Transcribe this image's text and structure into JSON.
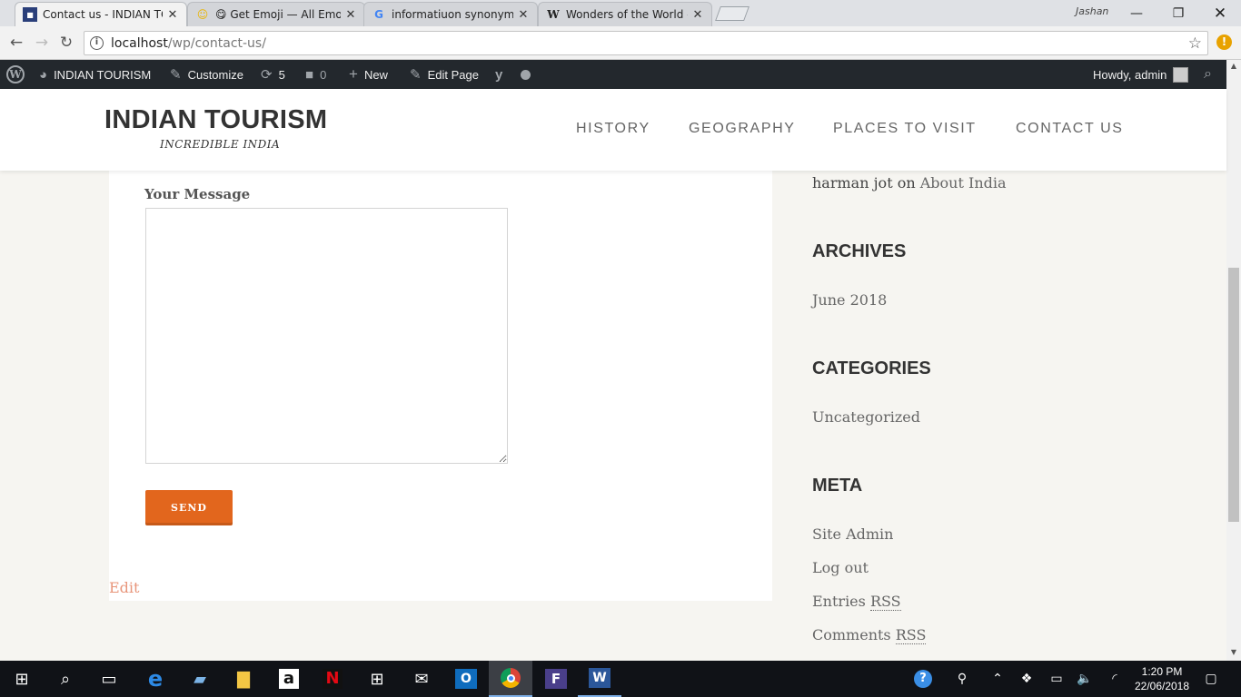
{
  "browser": {
    "tabs": [
      {
        "title": "Contact us - INDIAN TOU",
        "favicon": "site-favicon",
        "active": true
      },
      {
        "title": "😋 Get Emoji — All Emoj",
        "favicon": "emoji-favicon",
        "active": false
      },
      {
        "title": "informatiuon synonym - ",
        "favicon": "google-favicon",
        "active": false
      },
      {
        "title": "Wonders of the World - ",
        "favicon": "wikipedia-favicon",
        "active": false
      }
    ],
    "profile_name": "Jashan",
    "url_host": "localhost",
    "url_path": "/wp/contact-us/"
  },
  "adminbar": {
    "site_name": "INDIAN TOURISM",
    "customize": "Customize",
    "updates_count": "5",
    "comments_count": "0",
    "new_label": "New",
    "edit_page": "Edit Page",
    "howdy": "Howdy, admin"
  },
  "site": {
    "title": "INDIAN TOURISM",
    "tagline": "INCREDIBLE INDIA",
    "menu": [
      "HISTORY",
      "GEOGRAPHY",
      "PLACES TO VISIT",
      "CONTACT US"
    ]
  },
  "form": {
    "message_label": "Your Message",
    "message_value": "",
    "send_label": "SEND"
  },
  "edit_link": "Edit",
  "sidebar": {
    "recent_comment": {
      "author": "harman jot",
      "on": "on",
      "post": "About India"
    },
    "archives_title": "ARCHIVES",
    "archives": [
      "June 2018"
    ],
    "categories_title": "CATEGORIES",
    "categories": [
      "Uncategorized"
    ],
    "meta_title": "META",
    "meta": {
      "site_admin": "Site Admin",
      "log_out": "Log out",
      "entries": "Entries",
      "comments": "Comments",
      "rss": "RSS"
    }
  },
  "taskbar": {
    "time": "1:20 PM",
    "date": "22/06/2018"
  },
  "colors": {
    "accent": "#e2661d",
    "admin_bar": "#23282d",
    "page_bg": "#f6f5f1"
  }
}
